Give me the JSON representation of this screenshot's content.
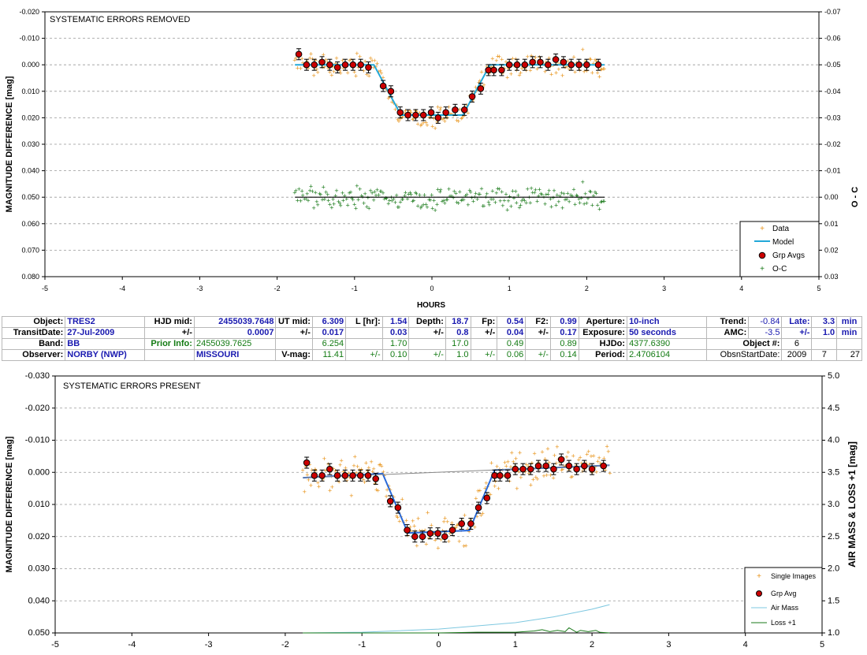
{
  "chart_data": [
    {
      "type": "scatter",
      "title": "SYSTEMATIC ERRORS REMOVED",
      "xlabel": "HOURS",
      "ylabel": "MAGNITUDE DIFFERENCE [mag]",
      "y2label": "O - C",
      "xlim": [
        -5,
        5
      ],
      "ylim": [
        -0.02,
        0.08
      ],
      "y_inverted": true,
      "y2lim": [
        -0.07,
        0.03
      ],
      "xticks": [
        "-5",
        "-4",
        "-3",
        "-2",
        "-1",
        "0",
        "1",
        "2",
        "3",
        "4",
        "5"
      ],
      "yticks": [
        "-0.020",
        "-0.010",
        "0.000",
        "0.010",
        "0.020",
        "0.030",
        "0.040",
        "0.050",
        "0.060",
        "0.070",
        "0.080"
      ],
      "y2ticks": [
        "-0.07",
        "-0.06",
        "-0.05",
        "-0.04",
        "-0.03",
        "-0.02",
        "-0.01",
        "0.00",
        "0.01",
        "0.02",
        "0.03"
      ],
      "legend": [
        "Data",
        "Model",
        "Grp Avgs",
        "O-C"
      ],
      "legend_position": "bottom-right",
      "model": {
        "x": [
          -1.77,
          -0.75,
          -0.4,
          0.4,
          0.75,
          2.23
        ],
        "y": [
          0.0,
          0.0,
          0.019,
          0.019,
          0.0,
          0.0
        ]
      },
      "grp_avgs": {
        "x": [
          -1.72,
          -1.62,
          -1.52,
          -1.42,
          -1.32,
          -1.22,
          -1.12,
          -1.02,
          -0.92,
          -0.82,
          -0.63,
          -0.53,
          -0.41,
          -0.31,
          -0.21,
          -0.11,
          -0.01,
          0.08,
          0.18,
          0.3,
          0.42,
          0.52,
          0.63,
          0.73,
          0.8,
          0.9,
          1.0,
          1.1,
          1.2,
          1.3,
          1.4,
          1.5,
          1.6,
          1.7,
          1.8,
          1.9,
          2.0,
          2.15
        ],
        "y": [
          -0.004,
          0.0,
          0.0,
          -0.001,
          0.0,
          0.001,
          0.0,
          0.0,
          0.0,
          0.001,
          0.008,
          0.01,
          0.018,
          0.019,
          0.019,
          0.019,
          0.018,
          0.02,
          0.018,
          0.017,
          0.017,
          0.012,
          0.009,
          0.002,
          0.002,
          0.002,
          0.0,
          0.0,
          0.0,
          -0.001,
          -0.001,
          0.0,
          -0.002,
          -0.001,
          0.0,
          0.0,
          0.0,
          0.0
        ]
      },
      "oc_baseline": 0.0
    },
    {
      "type": "scatter",
      "title": "SYSTEMATIC ERRORS PRESENT",
      "xlabel": "",
      "ylabel": "MAGNITUDE DIFFERENCE [mag]",
      "y2label": "AIR MASS & LOSS +1 [mag]",
      "xlim": [
        -5,
        5
      ],
      "ylim": [
        -0.03,
        0.05
      ],
      "y_inverted": true,
      "y2lim": [
        1.0,
        5.0
      ],
      "xticks": [
        "-5",
        "-4",
        "-3",
        "-2",
        "-1",
        "0",
        "1",
        "2",
        "3",
        "4",
        "5"
      ],
      "yticks": [
        "-0.030",
        "-0.020",
        "-0.010",
        "0.000",
        "0.010",
        "0.020",
        "0.030",
        "0.040",
        "0.050"
      ],
      "y2ticks": [
        "1.0",
        "1.5",
        "2.0",
        "2.5",
        "3.0",
        "3.5",
        "4.0",
        "4.5",
        "5.0"
      ],
      "legend": [
        "Single Images",
        "Grp Avg",
        "Air Mass",
        "Loss +1"
      ],
      "legend_position": "bottom-right",
      "model": {
        "x": [
          -1.77,
          -0.73,
          -0.4,
          0.4,
          0.73,
          2.23
        ],
        "y": [
          0.0017,
          0.0004,
          0.0189,
          0.0181,
          -0.0007,
          -0.0022
        ]
      },
      "grp_avgs": {
        "x": [
          -1.72,
          -1.62,
          -1.52,
          -1.42,
          -1.32,
          -1.22,
          -1.12,
          -1.02,
          -0.92,
          -0.82,
          -0.63,
          -0.53,
          -0.41,
          -0.31,
          -0.21,
          -0.11,
          -0.01,
          0.08,
          0.18,
          0.3,
          0.42,
          0.52,
          0.63,
          0.73,
          0.8,
          0.9,
          1.0,
          1.1,
          1.2,
          1.3,
          1.4,
          1.5,
          1.6,
          1.7,
          1.8,
          1.9,
          2.0,
          2.15
        ],
        "y": [
          -0.003,
          0.001,
          0.001,
          -0.001,
          0.001,
          0.001,
          0.001,
          0.001,
          0.001,
          0.002,
          0.009,
          0.011,
          0.018,
          0.02,
          0.02,
          0.019,
          0.019,
          0.02,
          0.018,
          0.016,
          0.016,
          0.011,
          0.008,
          0.001,
          0.001,
          0.001,
          -0.001,
          -0.001,
          -0.001,
          -0.002,
          -0.002,
          -0.001,
          -0.004,
          -0.002,
          -0.001,
          -0.002,
          -0.001,
          -0.002
        ]
      },
      "air_mass": {
        "x": [
          -1.77,
          -1.0,
          0.0,
          1.0,
          1.5,
          2.0,
          2.23
        ],
        "y": [
          1.0,
          1.01,
          1.06,
          1.16,
          1.25,
          1.37,
          1.44
        ]
      },
      "loss": {
        "x": [
          -1.77,
          -1.0,
          0.0,
          0.5,
          1.0,
          1.25,
          1.35,
          1.45,
          1.55,
          1.65,
          1.7,
          1.8,
          1.85,
          1.95,
          2.05,
          2.1,
          2.23
        ],
        "y": [
          1.0,
          1.0,
          1.0,
          1.01,
          1.01,
          1.03,
          1.05,
          1.02,
          1.04,
          1.02,
          1.08,
          1.01,
          1.04,
          1.02,
          1.04,
          1.01,
          1.0
        ]
      }
    }
  ],
  "info_table": {
    "r1": {
      "object_k": "Object:",
      "object_v": "TRES2",
      "hjdmid_k": "HJD mid:",
      "hjdmid_v": "2455039.7648",
      "utmid_k": "UT mid:",
      "utmid_v": "6.309",
      "lhr_k": "L [hr]:",
      "lhr_v": "1.54",
      "depth_k": "Depth:",
      "depth_v": "18.7",
      "fp_k": "Fp:",
      "fp_v": "0.54",
      "f2_k": "F2:",
      "f2_v": "0.99",
      "aperture_k": "Aperture:",
      "aperture_v": "10-inch",
      "trend_k": "Trend:",
      "trend_v": "-0.84",
      "late_k": "Late:",
      "late_v": "3.3",
      "late_u": "min"
    },
    "r2": {
      "td_k": "TransitDate:",
      "td_v": "27-Jul-2009",
      "pm1": "+/-",
      "hjd_err": "0.0007",
      "pm2": "+/-",
      "ut_err": "0.017",
      "l_err": "0.03",
      "pm3": "+/-",
      "depth_err": "0.8",
      "pm4": "+/-",
      "fp_err": "0.04",
      "pm5": "+/-",
      "f2_err": "0.17",
      "exposure_k": "Exposure:",
      "exposure_v": "50 seconds",
      "amc_k": "AMC:",
      "amc_v": "-3.5",
      "pm6": "+/-",
      "late_err": "1.0",
      "late_u": "min"
    },
    "r3": {
      "band_k": "Band:",
      "band_v": "BB",
      "prior_k": "Prior Info:",
      "prior_hjd": "2455039.7625",
      "prior_ut": "6.254",
      "prior_l": "1.70",
      "prior_depth": "17.0",
      "prior_fp": "0.49",
      "prior_f2": "0.89",
      "hjdo_k": "HJDo:",
      "hjdo_v": "4377.6390",
      "objnum_k": "Object #:",
      "objnum_v": "6"
    },
    "r4": {
      "observer_k": "Observer:",
      "observer_v": "NORBY (NWP)",
      "location_v": "MISSOURI",
      "vmag_k": "V-mag:",
      "vmag_v": "11.41",
      "pm1": "+/-",
      "vmag_err": "0.10",
      "pm2": "+/-",
      "depth_err": "1.0",
      "pm3": "+/-",
      "fp_err": "0.06",
      "pm4": "+/-",
      "f2_err": "0.14",
      "period_k": "Period:",
      "period_v": "2.4706104",
      "obsn_k": "ObsnStartDate:",
      "obsn_y": "2009",
      "obsn_m": "7",
      "obsn_d": "27"
    }
  },
  "colors": {
    "data": "#e8941a",
    "model": "#22a8d8",
    "grp": "#cc0000",
    "oc": "#1a7a1a",
    "airmass": "#7ec8e0",
    "loss": "#1a7a1a",
    "grid": "#999999"
  }
}
